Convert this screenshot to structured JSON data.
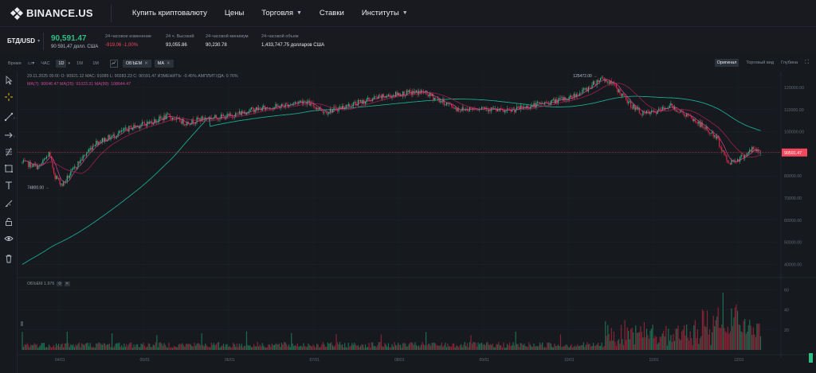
{
  "nav": {
    "logo_text": "BINANCE.US",
    "items": [
      {
        "label": "Купить криптовалюту",
        "caret": false
      },
      {
        "label": "Цены",
        "caret": false
      },
      {
        "label": "Торговля",
        "caret": true
      },
      {
        "label": "Ставки",
        "caret": false
      },
      {
        "label": "Институты",
        "caret": true
      }
    ]
  },
  "ticker": {
    "pair": "БТД/USD",
    "price": "90,591.47",
    "price_usd": "90 591,47 долл. США",
    "stats": [
      {
        "label": "24-часовое изменение",
        "value": "-919,06 -1,00%",
        "negative": true
      },
      {
        "label": "24 ч. Высокий",
        "value": "93,055.86",
        "negative": false
      },
      {
        "label": "24-часовой минимум",
        "value": "90,230.78",
        "negative": false
      },
      {
        "label": "24-часовой объем",
        "value": "1,433,747.75 долларов США",
        "negative": false
      }
    ]
  },
  "toolbar": {
    "time_label": "Время",
    "intervals": [
      "ЧАС",
      "1D",
      "1W",
      "1M"
    ],
    "active_interval": "1D",
    "chips": [
      "ОБЪЕМ",
      "MA"
    ],
    "views": [
      "Оригинал",
      "Торговый вид",
      "Глубина"
    ],
    "active_view": "Оригинал"
  },
  "legend": {
    "ohlc": "29.11.2025 05:00  O: 90921.12  MAC: 91085  L: 90283.23  C: 90591.47  ИЗМЕНИТЬ: -0.45%  АМПЛИТУДА: 0.76%",
    "ma": "MA(7): 90646.47  MA(25): 91023.31  MA(99): 108644.47",
    "volume": "ОБЪЕМ  1.976"
  },
  "colors": {
    "up": "#2ebd85",
    "down": "#e0294a",
    "ma7": "#c9469b",
    "ma25": "#9d1f4b",
    "ma99": "#1aa88f",
    "price_line": "#f6465d"
  },
  "chart_data": {
    "type": "candlestick",
    "price_axis_ticks": [
      120000,
      110000,
      100000,
      90000,
      80000,
      70000,
      60000,
      50000,
      40000
    ],
    "volume_axis_ticks": [
      60,
      40,
      20
    ],
    "time_axis_ticks": [
      "04/01",
      "05/01",
      "06/01",
      "07/01",
      "08/01",
      "09/01",
      "10/01",
      "11/01",
      "12/01"
    ],
    "last_price": 90591.47,
    "high_annotation": "125472.00",
    "low_annotation": "74800.00",
    "waypoints": [
      [
        0,
        86000
      ],
      [
        14,
        84000
      ],
      [
        22,
        90000
      ],
      [
        27,
        80000
      ],
      [
        33,
        76000
      ],
      [
        45,
        85000
      ],
      [
        60,
        95000
      ],
      [
        75,
        98000
      ],
      [
        90,
        102000
      ],
      [
        104,
        104000
      ],
      [
        120,
        107000
      ],
      [
        135,
        104000
      ],
      [
        150,
        106000
      ],
      [
        170,
        107000
      ],
      [
        190,
        110000
      ],
      [
        213,
        111500
      ],
      [
        232,
        114000
      ],
      [
        250,
        109000
      ],
      [
        270,
        112000
      ],
      [
        290,
        115000
      ],
      [
        310,
        117000
      ],
      [
        330,
        118000
      ],
      [
        347,
        113500
      ],
      [
        360,
        110000
      ],
      [
        380,
        111000
      ],
      [
        398,
        109000
      ],
      [
        414,
        111000
      ],
      [
        432,
        113000
      ],
      [
        450,
        115000
      ],
      [
        465,
        119000
      ],
      [
        478,
        124500
      ],
      [
        488,
        121000
      ],
      [
        500,
        113000
      ],
      [
        512,
        108000
      ],
      [
        524,
        109000
      ],
      [
        534,
        112000
      ],
      [
        546,
        108000
      ],
      [
        560,
        103000
      ],
      [
        573,
        97000
      ],
      [
        582,
        86000
      ],
      [
        592,
        88000
      ],
      [
        602,
        92000
      ],
      [
        609,
        90500
      ]
    ]
  }
}
